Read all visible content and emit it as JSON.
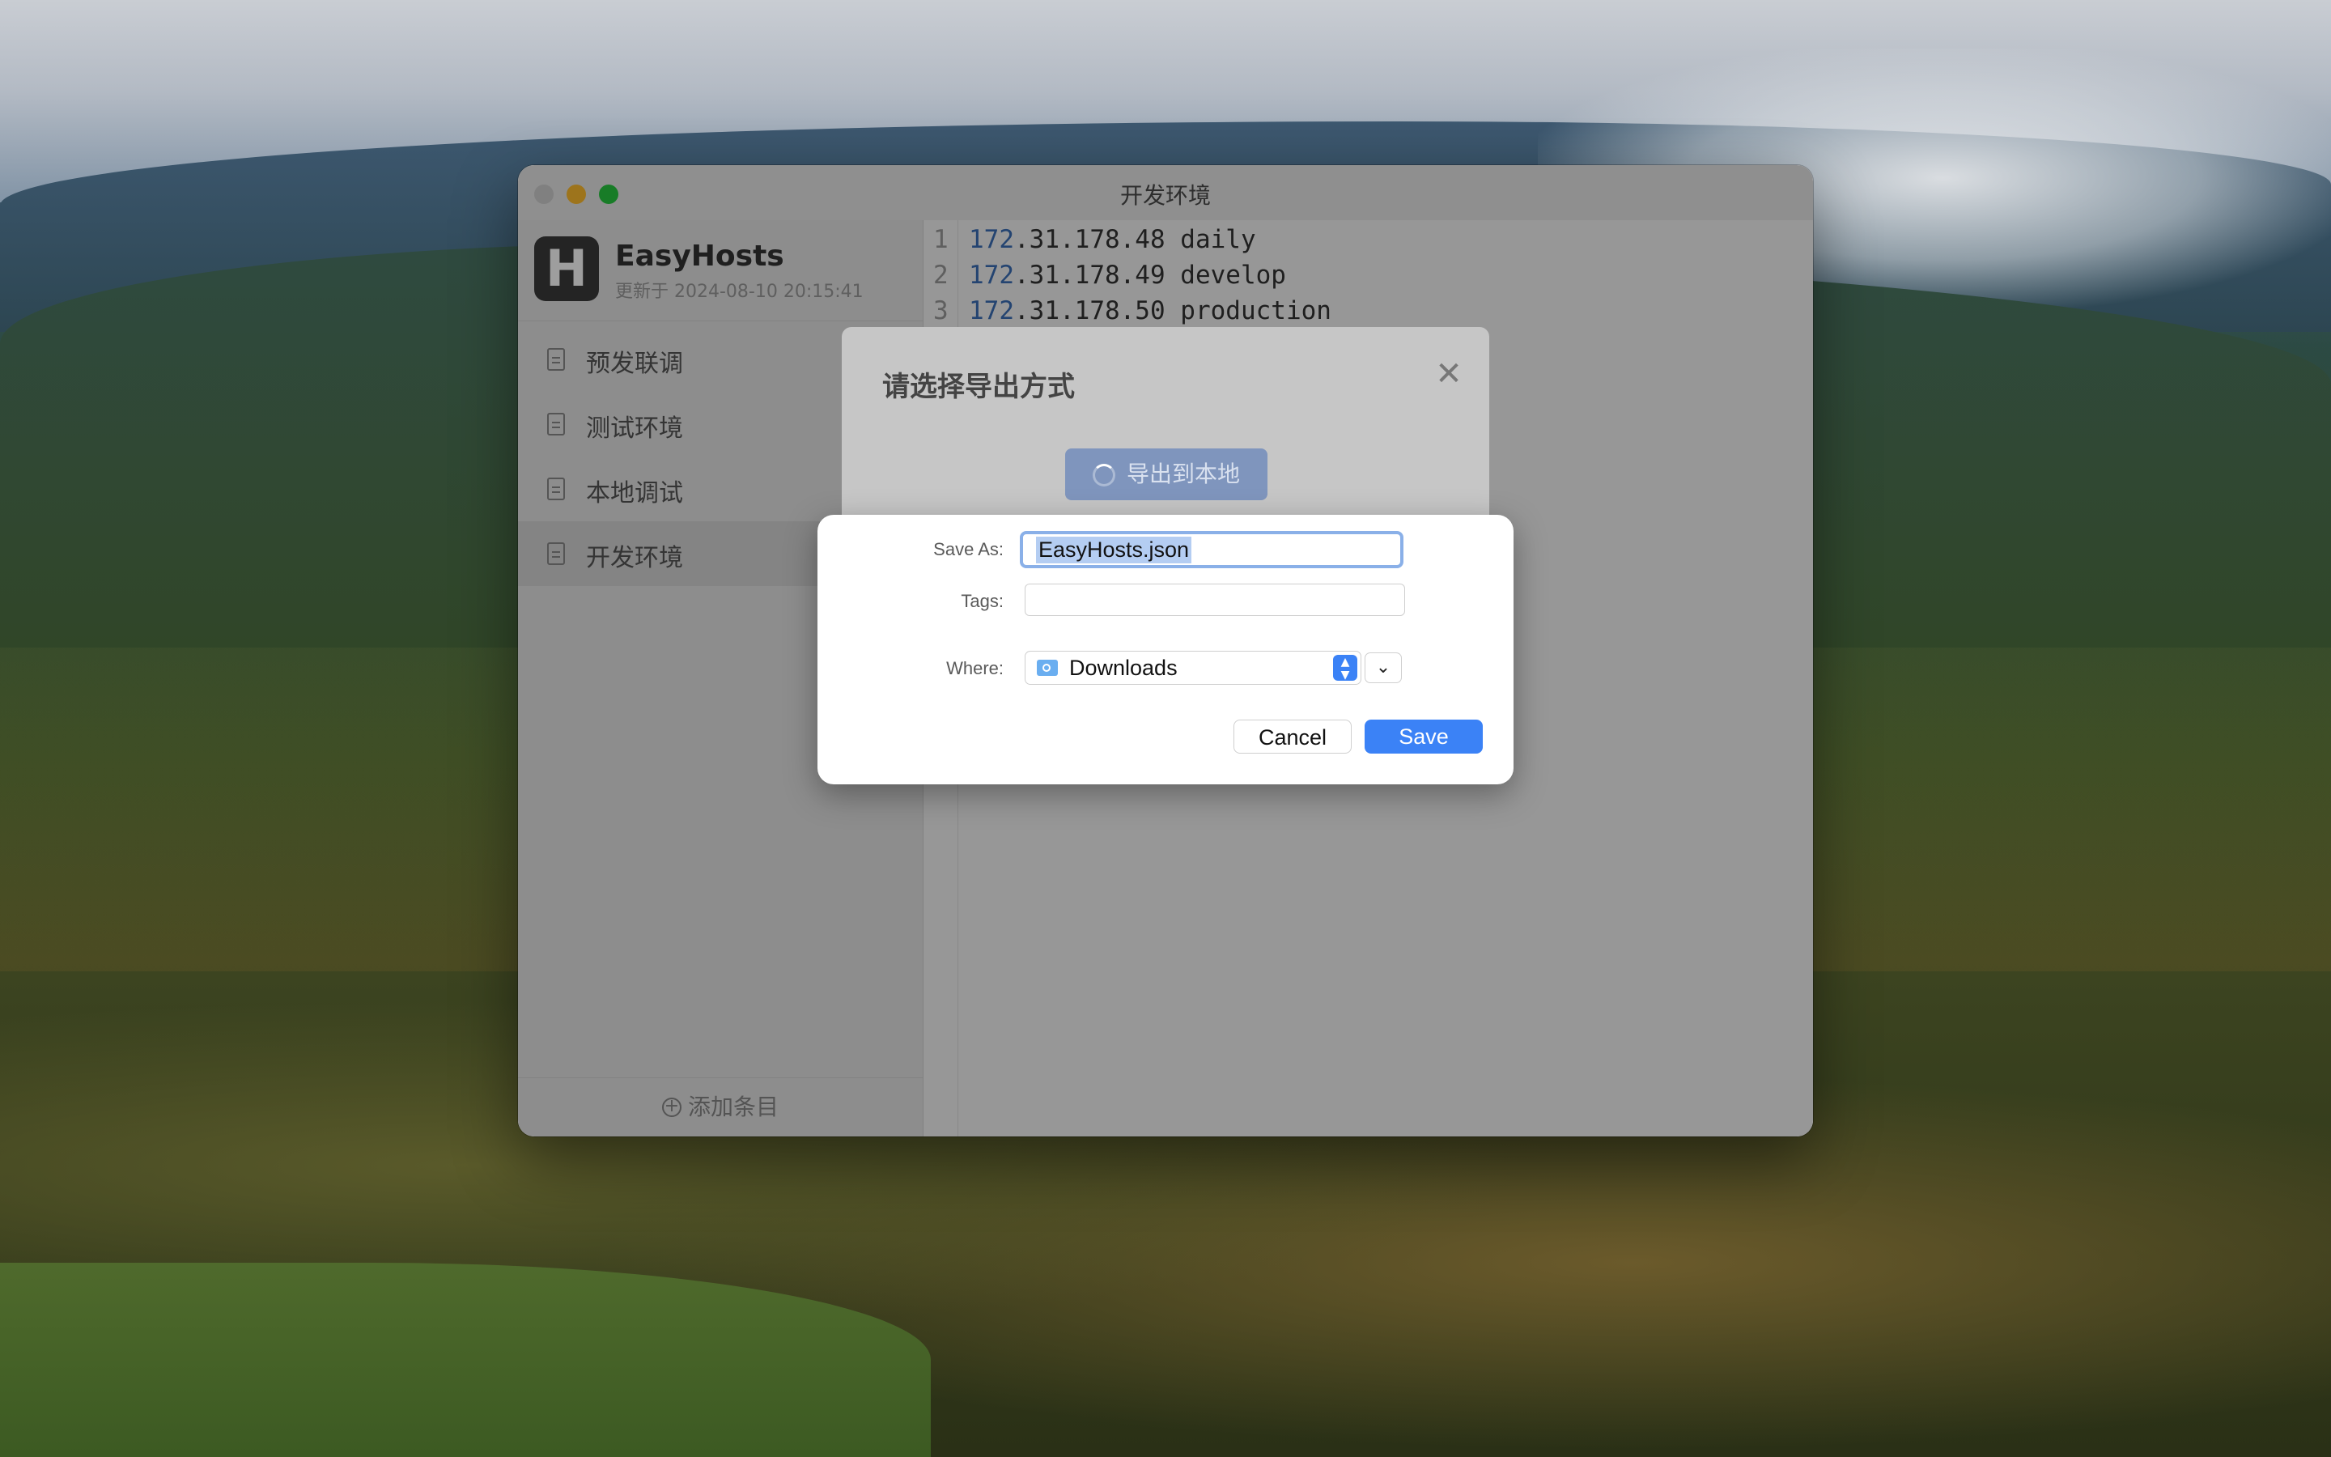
{
  "window": {
    "title": "开发环境"
  },
  "brand": {
    "logo_letter": "H",
    "name": "EasyHosts",
    "updated": "更新于 2024-08-10 20:15:41"
  },
  "sidebar": {
    "items": [
      {
        "label": "预发联调"
      },
      {
        "label": "测试环境"
      },
      {
        "label": "本地调试"
      },
      {
        "label": "开发环境"
      }
    ],
    "add_label": "添加条目"
  },
  "editor": {
    "lines": [
      {
        "num": "1",
        "octet": "172",
        "rest": ".31.178.48 daily"
      },
      {
        "num": "2",
        "octet": "172",
        "rest": ".31.178.49 develop"
      },
      {
        "num": "3",
        "octet": "172",
        "rest": ".31.178.50 production"
      }
    ]
  },
  "export_dialog": {
    "title": "请选择导出方式",
    "close_glyph": "✕",
    "export_button": "导出到本地"
  },
  "save_sheet": {
    "save_as_label": "Save As:",
    "filename": "EasyHosts.json",
    "tags_label": "Tags:",
    "where_label": "Where:",
    "where_value": "Downloads",
    "expand_glyph": "⌄",
    "cancel_label": "Cancel",
    "save_label": "Save"
  },
  "colors": {
    "accent": "#3b82f6",
    "traffic_min": "#febc2e",
    "traffic_max": "#28c840"
  }
}
